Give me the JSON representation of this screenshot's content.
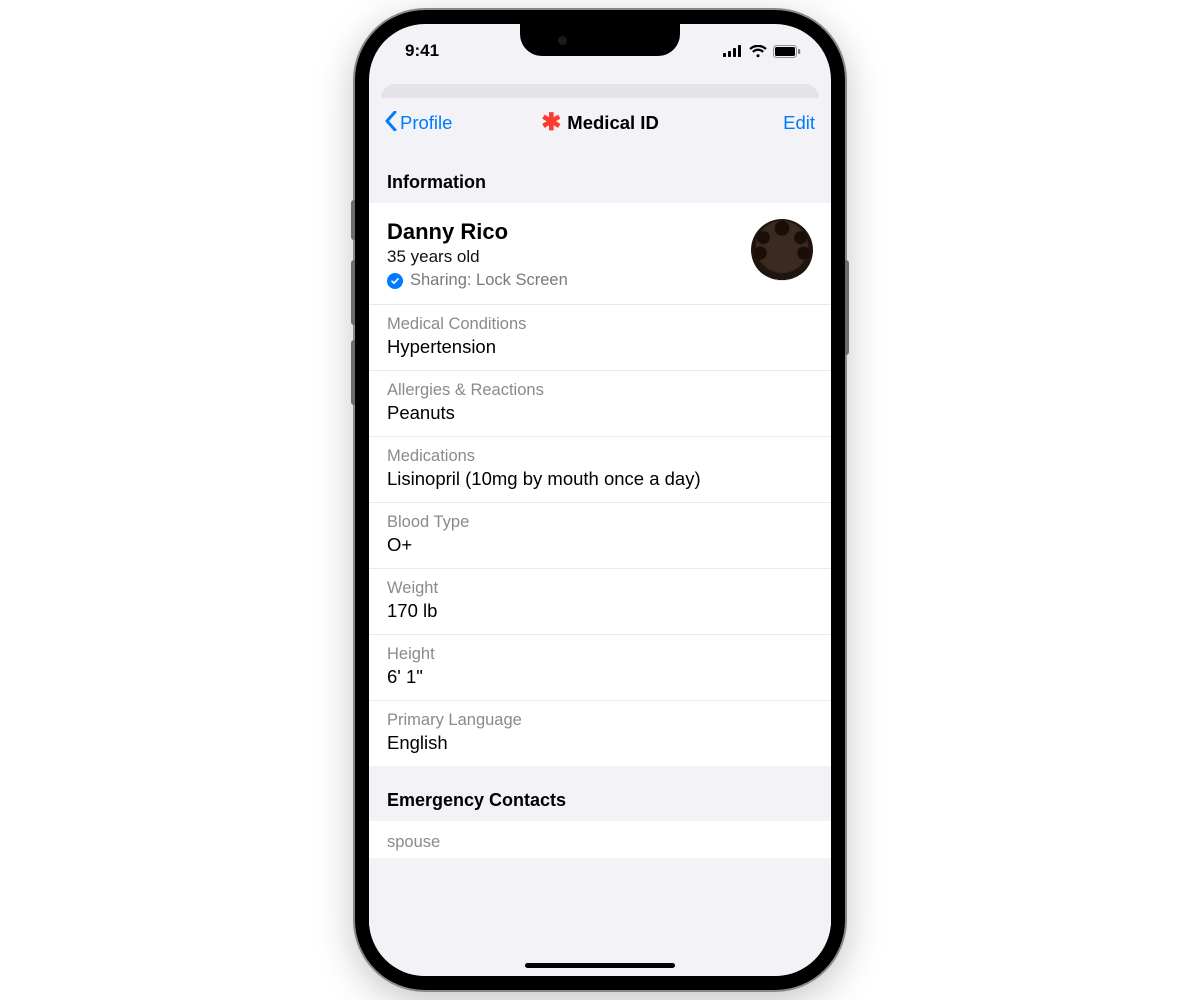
{
  "status": {
    "time": "9:41"
  },
  "nav": {
    "back_label": "Profile",
    "title": "Medical ID",
    "edit_label": "Edit"
  },
  "sections": {
    "information_header": "Information",
    "emergency_header": "Emergency Contacts"
  },
  "profile": {
    "name": "Danny Rico",
    "age": "35 years old",
    "sharing": "Sharing: Lock Screen"
  },
  "info": {
    "medical_conditions": {
      "label": "Medical Conditions",
      "value": "Hypertension"
    },
    "allergies": {
      "label": "Allergies & Reactions",
      "value": "Peanuts"
    },
    "medications": {
      "label": "Medications",
      "value": "Lisinopril (10mg by mouth once a day)"
    },
    "blood_type": {
      "label": "Blood Type",
      "value": "O+"
    },
    "weight": {
      "label": "Weight",
      "value": "170 lb"
    },
    "height": {
      "label": "Height",
      "value": "6' 1\""
    },
    "language": {
      "label": "Primary Language",
      "value": "English"
    }
  },
  "contacts": [
    {
      "relation": "spouse"
    }
  ]
}
